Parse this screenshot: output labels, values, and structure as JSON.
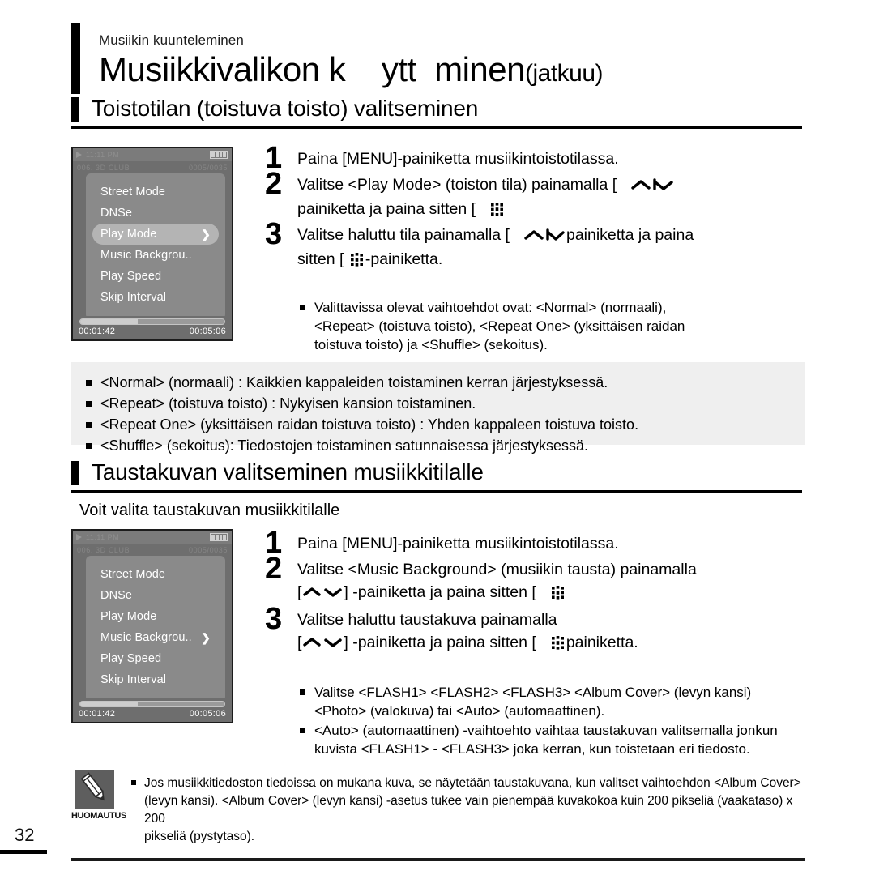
{
  "header": {
    "eyebrow": "Musiikin kuunteleminen",
    "title": "Musiikkivalikon k    ytt  minen",
    "title_suffix": "(jatkuu)"
  },
  "page_number": "32",
  "sections": [
    {
      "heading": "Toistotilan (toistuva toisto) valitseminen",
      "device": {
        "status_time": "11:11 PM",
        "track_info": "006. 3D CLUB",
        "track_counter": "0005/0035",
        "menu_items": [
          {
            "label": "Street Mode",
            "selected": false,
            "chevron": false
          },
          {
            "label": "DNSe",
            "selected": false,
            "chevron": false
          },
          {
            "label": "Play Mode",
            "selected": true,
            "chevron": true
          },
          {
            "label": "Music Backgrou..",
            "selected": false,
            "chevron": false
          },
          {
            "label": "Play Speed",
            "selected": false,
            "chevron": false
          },
          {
            "label": "Skip Interval",
            "selected": false,
            "chevron": false
          }
        ],
        "elapsed": "00:01:42",
        "total": "00:05:06",
        "progress_percent": 40
      },
      "steps": [
        {
          "num": "1",
          "lines": [
            [
              {
                "t": "Paina [MENU]-painiketta musiikintoistotilassa."
              }
            ]
          ]
        },
        {
          "num": "2",
          "lines": [
            [
              {
                "t": "Valitse <Play Mode> (toiston tila) painamalla ["
              },
              {
                "gap": true
              },
              {
                "icon": "chevron-up"
              },
              {
                "icon": "chevron-down"
              }
            ],
            [
              {
                "t": "painiketta ja paina sitten ["
              },
              {
                "gap": true
              },
              {
                "icon": "menu-dots"
              }
            ]
          ]
        },
        {
          "num": "3",
          "lines": [
            [
              {
                "t": "Valitse haluttu tila painamalla ["
              },
              {
                "gap": true
              },
              {
                "icon": "chevron-up"
              },
              {
                "icon": "chevron-down"
              },
              {
                "t": "painiketta ja paina"
              }
            ],
            [
              {
                "t": "sitten ["
              },
              {
                "icon": "menu-dots"
              },
              {
                "t": "-painiketta."
              }
            ]
          ]
        }
      ],
      "sub_bullets": [
        "Valittavissa olevat vaihtoehdot ovat: <Normal> (normaali),\n<Repeat> (toistuva toisto), <Repeat One> (yksittäisen raidan\ntoistuva toisto) ja <Shuffle> (sekoitus)."
      ],
      "gray_bullets": [
        "<Normal> (normaali) : Kaikkien kappaleiden toistaminen kerran järjestyksessä.",
        "<Repeat> (toistuva toisto) : Nykyisen kansion toistaminen.",
        "<Repeat One> (yksittäisen raidan toistuva toisto) : Yhden kappaleen toistuva toisto.",
        "<Shuffle> (sekoitus): Tiedostojen toistaminen satunnaisessa järjestyksessä."
      ]
    },
    {
      "heading": "Taustakuvan valitseminen musiikkitilalle",
      "subtitle": "Voit valita taustakuvan musiikkitilalle",
      "device": {
        "status_time": "11:11 PM",
        "track_info": "006. 3D CLUB",
        "track_counter": "0005/0035",
        "menu_items": [
          {
            "label": "Street Mode",
            "selected": false,
            "chevron": false
          },
          {
            "label": "DNSe",
            "selected": false,
            "chevron": false
          },
          {
            "label": "Play Mode",
            "selected": false,
            "chevron": false
          },
          {
            "label": "Music Backgrou..",
            "selected": false,
            "chevron": true
          },
          {
            "label": "Play Speed",
            "selected": false,
            "chevron": false
          },
          {
            "label": "Skip Interval",
            "selected": false,
            "chevron": false
          }
        ],
        "elapsed": "00:01:42",
        "total": "00:05:06",
        "progress_percent": 40
      },
      "steps": [
        {
          "num": "1",
          "lines": [
            [
              {
                "t": "Paina [MENU]-painiketta musiikintoistotilassa."
              }
            ]
          ]
        },
        {
          "num": "2",
          "lines": [
            [
              {
                "t": "Valitse <Music Background> (musiikin tausta) painamalla"
              }
            ],
            [
              {
                "t": "["
              },
              {
                "icon": "chevron-up"
              },
              {
                "icon": "chevron-down"
              },
              {
                "t": "] -painiketta ja paina sitten ["
              },
              {
                "gap": true
              },
              {
                "icon": "menu-dots"
              }
            ]
          ]
        },
        {
          "num": "3",
          "lines": [
            [
              {
                "t": "Valitse haluttu taustakuva painamalla"
              }
            ],
            [
              {
                "t": "["
              },
              {
                "icon": "chevron-up"
              },
              {
                "icon": "chevron-down"
              },
              {
                "t": "] -painiketta ja paina sitten ["
              },
              {
                "gap": true
              },
              {
                "icon": "menu-dots"
              },
              {
                "t": "painiketta."
              }
            ]
          ]
        }
      ],
      "sub_bullets": [
        "Valitse <FLASH1> <FLASH2> <FLASH3> <Album Cover> (levyn kansi)\n<Photo> (valokuva) tai <Auto> (automaattinen).",
        "<Auto> (automaattinen) -vaihtoehto vaihtaa taustakuvan valitsemalla jonkun\nkuvista <FLASH1> - <FLASH3> joka kerran, kun toistetaan eri tiedosto."
      ]
    }
  ],
  "note": {
    "label": "HUOMAUTUS",
    "icon": "pencil-icon",
    "bullets": [
      "Jos musiikkitiedoston tiedoissa on mukana kuva, se näytetään taustakuvana, kun valitset vaihtoehdon <Album Cover>\n(levyn kansi). <Album Cover> (levyn kansi) -asetus tukee vain pienempää kuvakokoa kuin 200 pikseliä (vaakataso) x 200\npikseliä (pystytaso)."
    ]
  },
  "colors": {
    "device_body": "#6e6e6e",
    "device_menu": "#8a8a8a",
    "device_highlight": "#b4b4b4",
    "gray_box": "#efefef",
    "note_badge": "#5e5e5e",
    "rule": "#000000"
  }
}
